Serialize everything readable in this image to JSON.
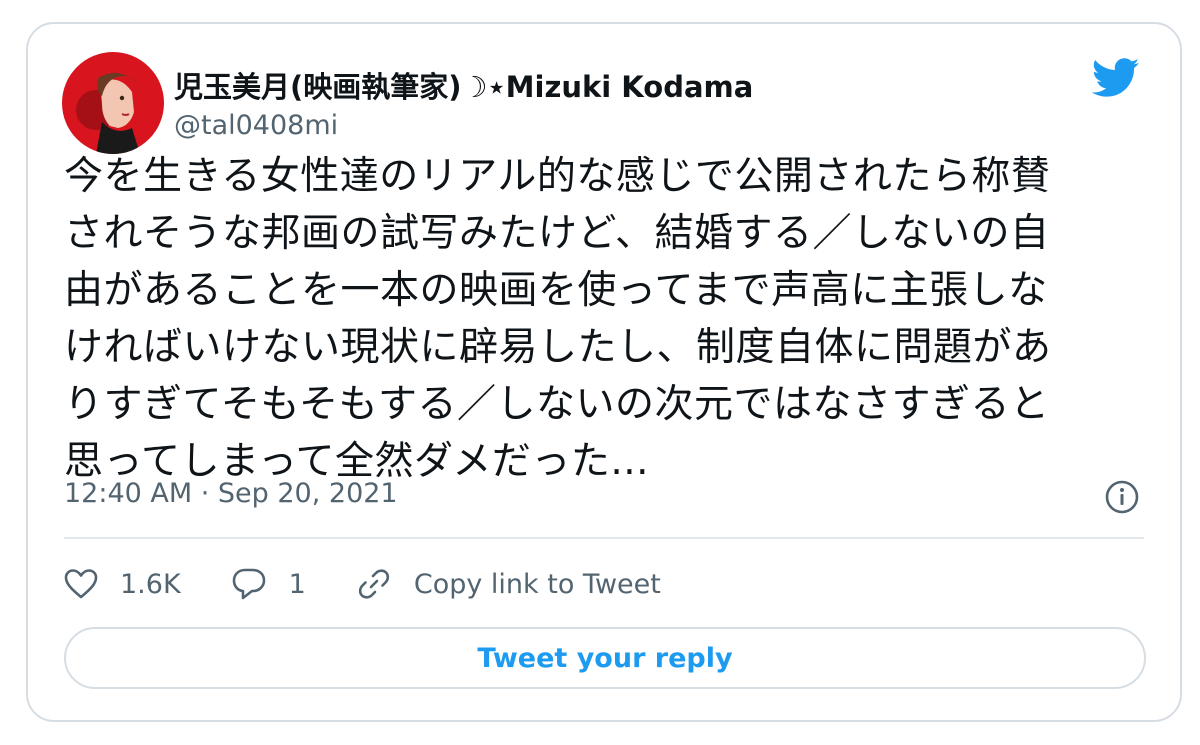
{
  "author": {
    "display_name": "児玉美月(映画執筆家)☽⋆Mizuki Kodama",
    "handle": "@tal0408mi"
  },
  "tweet": {
    "lines": [
      "今を生きる女性達のリアル的な感じで公開されたら称賛",
      "されそうな邦画の試写みたけど、結婚する／しないの自",
      "由があることを一本の映画を使ってまで声高に主張しな",
      "ければいけない現状に辟易したし、制度自体に問題があ",
      "りすぎてそもそもする／しないの次元ではなさすぎると",
      "思ってしまって全然ダメだった..."
    ],
    "timestamp": "12:40 AM · Sep 20, 2021"
  },
  "actions": {
    "like_count": "1.6K",
    "reply_count": "1",
    "copy_link_label": "Copy link to Tweet"
  },
  "reply_button_label": "Tweet your reply",
  "icons": {
    "brand": "twitter-bird-icon",
    "info": "info-icon",
    "like": "heart-icon",
    "reply": "comment-bubble-icon",
    "link": "link-icon"
  },
  "colors": {
    "brand_blue": "#1d9bf0",
    "text": "#0f1419",
    "secondary_text": "#536471",
    "border": "#d6dde3"
  }
}
